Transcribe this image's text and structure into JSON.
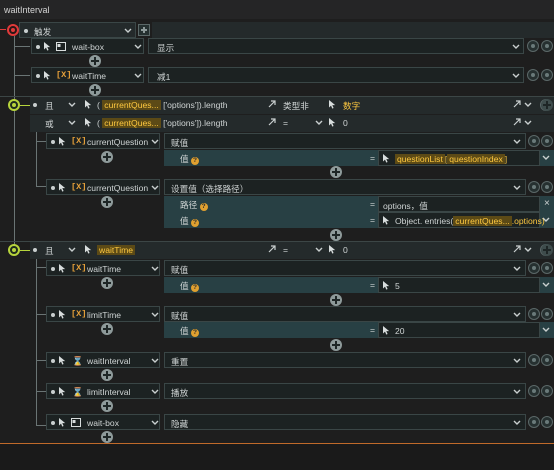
{
  "window_title": "waitInterval",
  "trigger_label": "触发",
  "actions": {
    "wait_box_1": {
      "target": "wait-box",
      "value": "显示"
    },
    "wait_time_1": {
      "target": "waitTime",
      "value": "减1"
    }
  },
  "cond1": {
    "logic": "且",
    "expr_part1": "currentQues...",
    "expr_part2": "['options']).length",
    "operator": "类型非",
    "rhs": "数字"
  },
  "cond2": {
    "logic": "或",
    "expr_part1": "currentQues...",
    "expr_part2": "['options']).length",
    "operator": "=",
    "rhs": "0"
  },
  "assign1": {
    "target": "currentQuestion",
    "action": "赋值",
    "value_label": "值",
    "value_tag1": "questionList",
    "value_tag2": "questionIndex"
  },
  "assign2": {
    "target": "currentQuestion",
    "action": "设置值（选择路径）",
    "path_label": "路径",
    "path_value": "options，值",
    "value_label": "值",
    "value_prefix": "Object. entries(",
    "value_tag": "currentQues...",
    "value_suffix": ".options)"
  },
  "cond3": {
    "logic": "且",
    "expr_tag": "waitTime",
    "operator": "=",
    "rhs": "0"
  },
  "assign3": {
    "target": "waitTime",
    "action": "赋值",
    "value_label": "值",
    "value": "5"
  },
  "assign4": {
    "target": "limitTime",
    "action": "赋值",
    "value_label": "值",
    "value": "20"
  },
  "timer1": {
    "target": "waitInterval",
    "action": "重置"
  },
  "timer2": {
    "target": "limitInterval",
    "action": "播放"
  },
  "wait_box_2": {
    "target": "wait-box",
    "value": "隐藏"
  },
  "glyphs": {
    "var_icon": "[X]",
    "open_paren": "(",
    "close_paren": ")",
    "eq_sign": "=",
    "help": "?",
    "hourglass": "⌛",
    "close": "×"
  },
  "colors": {
    "accent_var": "#e8a23a",
    "tag_bg": "#5c4a16",
    "tag_fg": "#ffc940",
    "toggle_green": "#b7d43c",
    "toggle_red": "#e03a3a"
  }
}
